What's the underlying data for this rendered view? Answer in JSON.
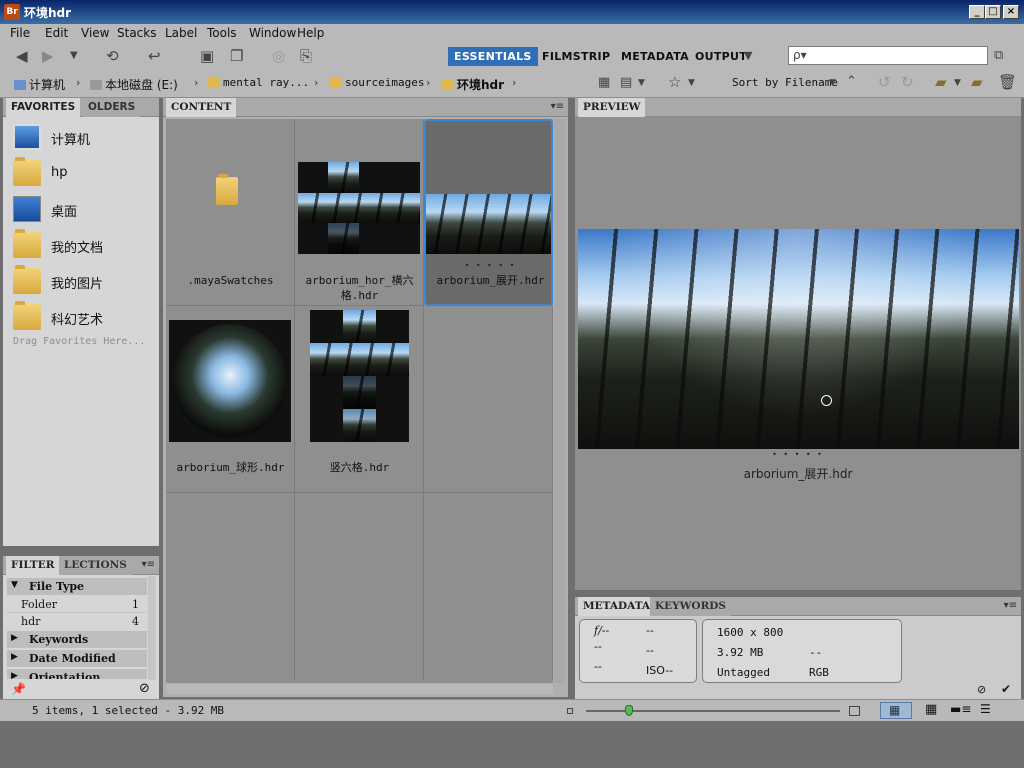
{
  "window": {
    "title": "环境hdr",
    "app_icon": "Br"
  },
  "menu": [
    "File",
    "Edit",
    "View",
    "Stacks",
    "Label",
    "Tools",
    "Window",
    "Help"
  ],
  "workspaces": [
    "ESSENTIALS",
    "FILMSTRIP",
    "METADATA",
    "OUTPUT"
  ],
  "search": {
    "placeholder": "ρ▾"
  },
  "breadcrumb": [
    "计算机",
    "本地磁盘 (E:)",
    "mental ray...",
    "sourceimages",
    "环境hdr"
  ],
  "sort": {
    "label": "Sort by Filename"
  },
  "panels": {
    "favorites_tab": "FAVORITES",
    "folders_tab": "OLDERS",
    "content_tab": "CONTENT",
    "preview_tab": "PREVIEW",
    "filter_tab": "FILTER",
    "collections_tab": "LECTIONS",
    "metadata_tab": "METADATA",
    "keywords_tab": "KEYWORDS"
  },
  "favorites": [
    {
      "label": "计算机",
      "icon": "computer-icon"
    },
    {
      "label": "hp",
      "icon": "folder-icon"
    },
    {
      "label": "桌面",
      "icon": "desktop-icon"
    },
    {
      "label": "我的文档",
      "icon": "documents-folder-icon"
    },
    {
      "label": "我的图片",
      "icon": "pictures-folder-icon"
    },
    {
      "label": "科幻艺术",
      "icon": "folder-icon"
    }
  ],
  "drag_hint": "Drag Favorites Here...",
  "filter": {
    "sections": [
      "File Type",
      "Keywords",
      "Date Modified",
      "Orientation"
    ],
    "file_types": [
      {
        "label": "Folder",
        "count": "1"
      },
      {
        "label": "hdr",
        "count": "4"
      }
    ]
  },
  "content_items": [
    {
      "name": ".mayaSwatches",
      "kind": "folder"
    },
    {
      "name": "arborium_hor_横六格.hdr",
      "line1": "arborium_hor_横六",
      "line2": "格.hdr",
      "kind": "cross-h"
    },
    {
      "name": "arborium_展开.hdr",
      "dots": "• • • • •",
      "kind": "pano",
      "selected": true
    },
    {
      "name": "arborium_球形.hdr",
      "kind": "sphere"
    },
    {
      "name": "竖六格.hdr",
      "kind": "cross-v"
    }
  ],
  "preview": {
    "caption": "arborium_展开.hdr",
    "dots": "• • • • •"
  },
  "metadata": {
    "fstop": "f/--",
    "shutter": "--",
    "left_col": [
      "--",
      "--"
    ],
    "mid_col": [
      "--",
      "ISO--"
    ],
    "dimensions": "1600 x 800",
    "size": "3.92 MB",
    "tag": "Untagged",
    "mode": "RGB",
    "extra": "--"
  },
  "status": {
    "text": "5 items, 1 selected - 3.92 MB",
    "zoom_level": 0.17
  },
  "colors": {
    "accent": "#2f6fb7",
    "selection_border": "#3b86d0",
    "titlebar": "#0a246a"
  }
}
